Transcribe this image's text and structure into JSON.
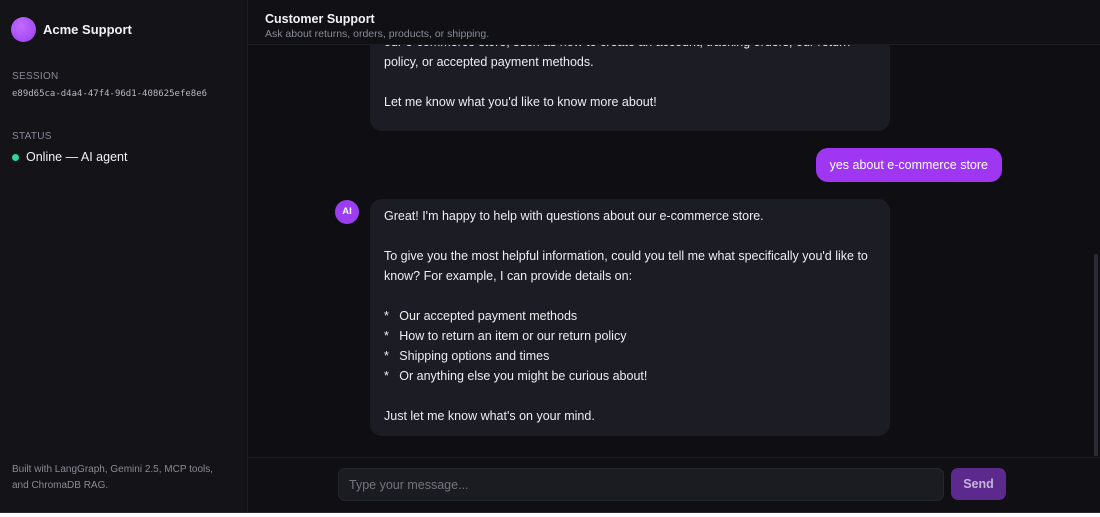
{
  "sidebar": {
    "brand_name": "Acme Support",
    "session_label": "SESSION",
    "session_id": "e89d65ca-d4a4-47f4-96d1-408625efe8e6",
    "status_label": "STATUS",
    "status_text": "Online — AI agent",
    "footer_text": "Built with LangGraph, Gemini 2.5, MCP tools, and ChromaDB RAG."
  },
  "header": {
    "title": "Customer Support",
    "subtitle": "Ask about returns, orders, products, or shipping."
  },
  "messages": [
    {
      "role": "assistant",
      "text": "our e-commerce store, such as how to create an account, tracking orders, our return policy, or accepted payment methods.\n\nLet me know what you'd like to know more about!"
    },
    {
      "role": "user",
      "text": "yes about e-commerce store"
    },
    {
      "role": "assistant",
      "avatar": "AI",
      "text": "Great! I'm happy to help with questions about our e-commerce store.\n\nTo give you the most helpful information, could you tell me what specifically you'd like to know? For example, I can provide details on:\n\n*   Our accepted payment methods\n*   How to return an item or our return policy\n*   Shipping options and times\n*   Or anything else you might be curious about!\n\nJust let me know what's on your mind."
    }
  ],
  "composer": {
    "placeholder": "Type your message...",
    "send_label": "Send"
  },
  "colors": {
    "accent": "#9b3df0",
    "online": "#34d399",
    "background": "#0f0f14"
  }
}
